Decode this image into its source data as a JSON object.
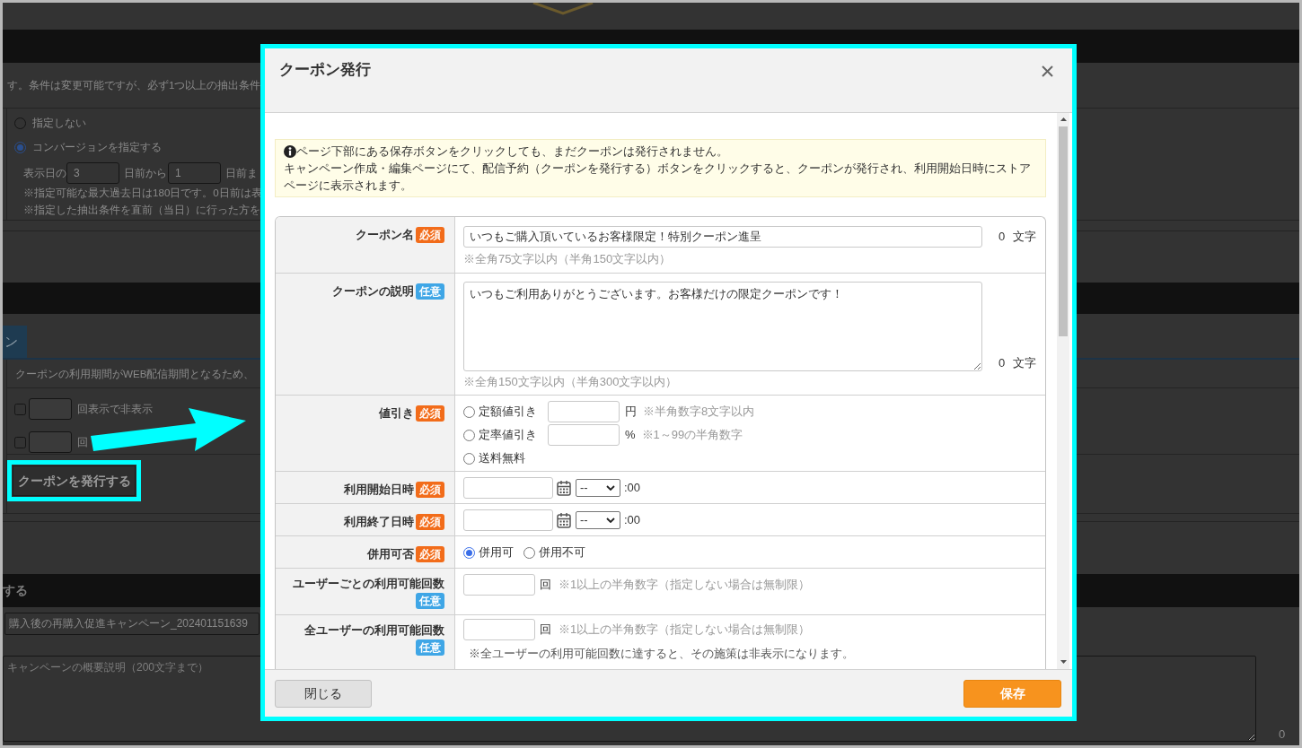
{
  "background_page": {
    "intro_text": "す。条件は変更可能ですが、必ず1つ以上の抽出条件",
    "conversion_options": [
      {
        "label": "指定しない",
        "selected": false
      },
      {
        "label": "コンバージョンを指定する",
        "selected": true
      }
    ],
    "display_days": {
      "prefix": "表示日の",
      "from_value": "3",
      "from_label": "日前から",
      "to_value": "1",
      "to_label": "日前ま"
    },
    "notes": [
      "※指定可能な最大過去日は180日です。0日前は表",
      "※指定した抽出条件を直前（当日）に行った方を"
    ],
    "tabs": [
      {
        "label": "ン",
        "selected": true
      }
    ],
    "period_note": "クーポンの利用期間がWEB配信期間となるため、",
    "hide_rules": [
      {
        "checked": false,
        "label": "回表示で非表示"
      },
      {
        "checked": false,
        "label": "回"
      }
    ],
    "issue_button": {
      "label": "クーポンを発行する"
    },
    "section_title": "する",
    "campaign_name": {
      "value": "購入後の再購入促進キャンペーン_202401151639"
    },
    "campaign_description": {
      "placeholder": "キャンペーンの概要説明（200文字まで）",
      "count": "0"
    }
  },
  "dialog": {
    "title": "クーポン発行",
    "info": [
      "ページ下部にある保存ボタンをクリックしても、まだクーポンは発行されません。",
      "キャンペーン作成・編集ページにて、配信予約（クーポンを発行する）ボタンをクリックすると、クーポンが発行され、利用開始日時にストアページに表示されます。"
    ],
    "fields": [
      {
        "kind": "text",
        "label": "クーポン名",
        "badge": {
          "text": "必須",
          "color": "#f26c1a"
        },
        "value": "いつもご購入頂いているお客様限定！特別クーポン進呈",
        "count": "0",
        "count_unit": "文字",
        "note": "※全角75文字以内（半角150文字以内）"
      },
      {
        "kind": "textarea",
        "label": "クーポンの説明",
        "badge": {
          "text": "任意",
          "color": "#3fa6e6"
        },
        "value": "いつもご利用ありがとうございます。お客様だけの限定クーポンです！",
        "count": "0",
        "count_unit": "文字",
        "note": "※全角150文字以内（半角300文字以内）"
      },
      {
        "kind": "discount",
        "label": "値引き",
        "badge": {
          "text": "必須",
          "color": "#f26c1a"
        },
        "options": [
          {
            "label": "定額値引き",
            "selected": false,
            "unit": "円",
            "note": "※半角数字8文字以内"
          },
          {
            "label": "定率値引き",
            "selected": false,
            "unit": "%",
            "note": "※1～99の半角数字"
          },
          {
            "label": "送料無料",
            "selected": false
          }
        ]
      },
      {
        "kind": "datetime",
        "label": "利用開始日時",
        "badge": {
          "text": "必須",
          "color": "#f26c1a"
        },
        "hour": "--",
        "suffix": ":00"
      },
      {
        "kind": "datetime",
        "label": "利用終了日時",
        "badge": {
          "text": "必須",
          "color": "#f26c1a"
        },
        "hour": "--",
        "suffix": ":00"
      },
      {
        "kind": "radio",
        "label": "併用可否",
        "badge": {
          "text": "必須",
          "color": "#f26c1a"
        },
        "options": [
          {
            "label": "併用可",
            "selected": true
          },
          {
            "label": "併用不可",
            "selected": false
          }
        ]
      },
      {
        "kind": "count",
        "label": "ユーザーごとの利用可能回数",
        "badge": {
          "text": "任意",
          "color": "#3fa6e6"
        },
        "unit": "回",
        "note": "※1以上の半角数字（指定しない場合は無制限）"
      },
      {
        "kind": "count",
        "label": "全ユーザーの利用可能回数",
        "badge": {
          "text": "任意",
          "color": "#3fa6e6"
        },
        "unit": "回",
        "note": "※1以上の半角数字（指定しない場合は無制限）",
        "extra_note": "※全ユーザーの利用可能回数に達すると、その施策は非表示になります。"
      }
    ],
    "buttons": [
      {
        "label": "閉じる",
        "kind": "secondary"
      },
      {
        "label": "保存",
        "kind": "primary"
      }
    ]
  }
}
